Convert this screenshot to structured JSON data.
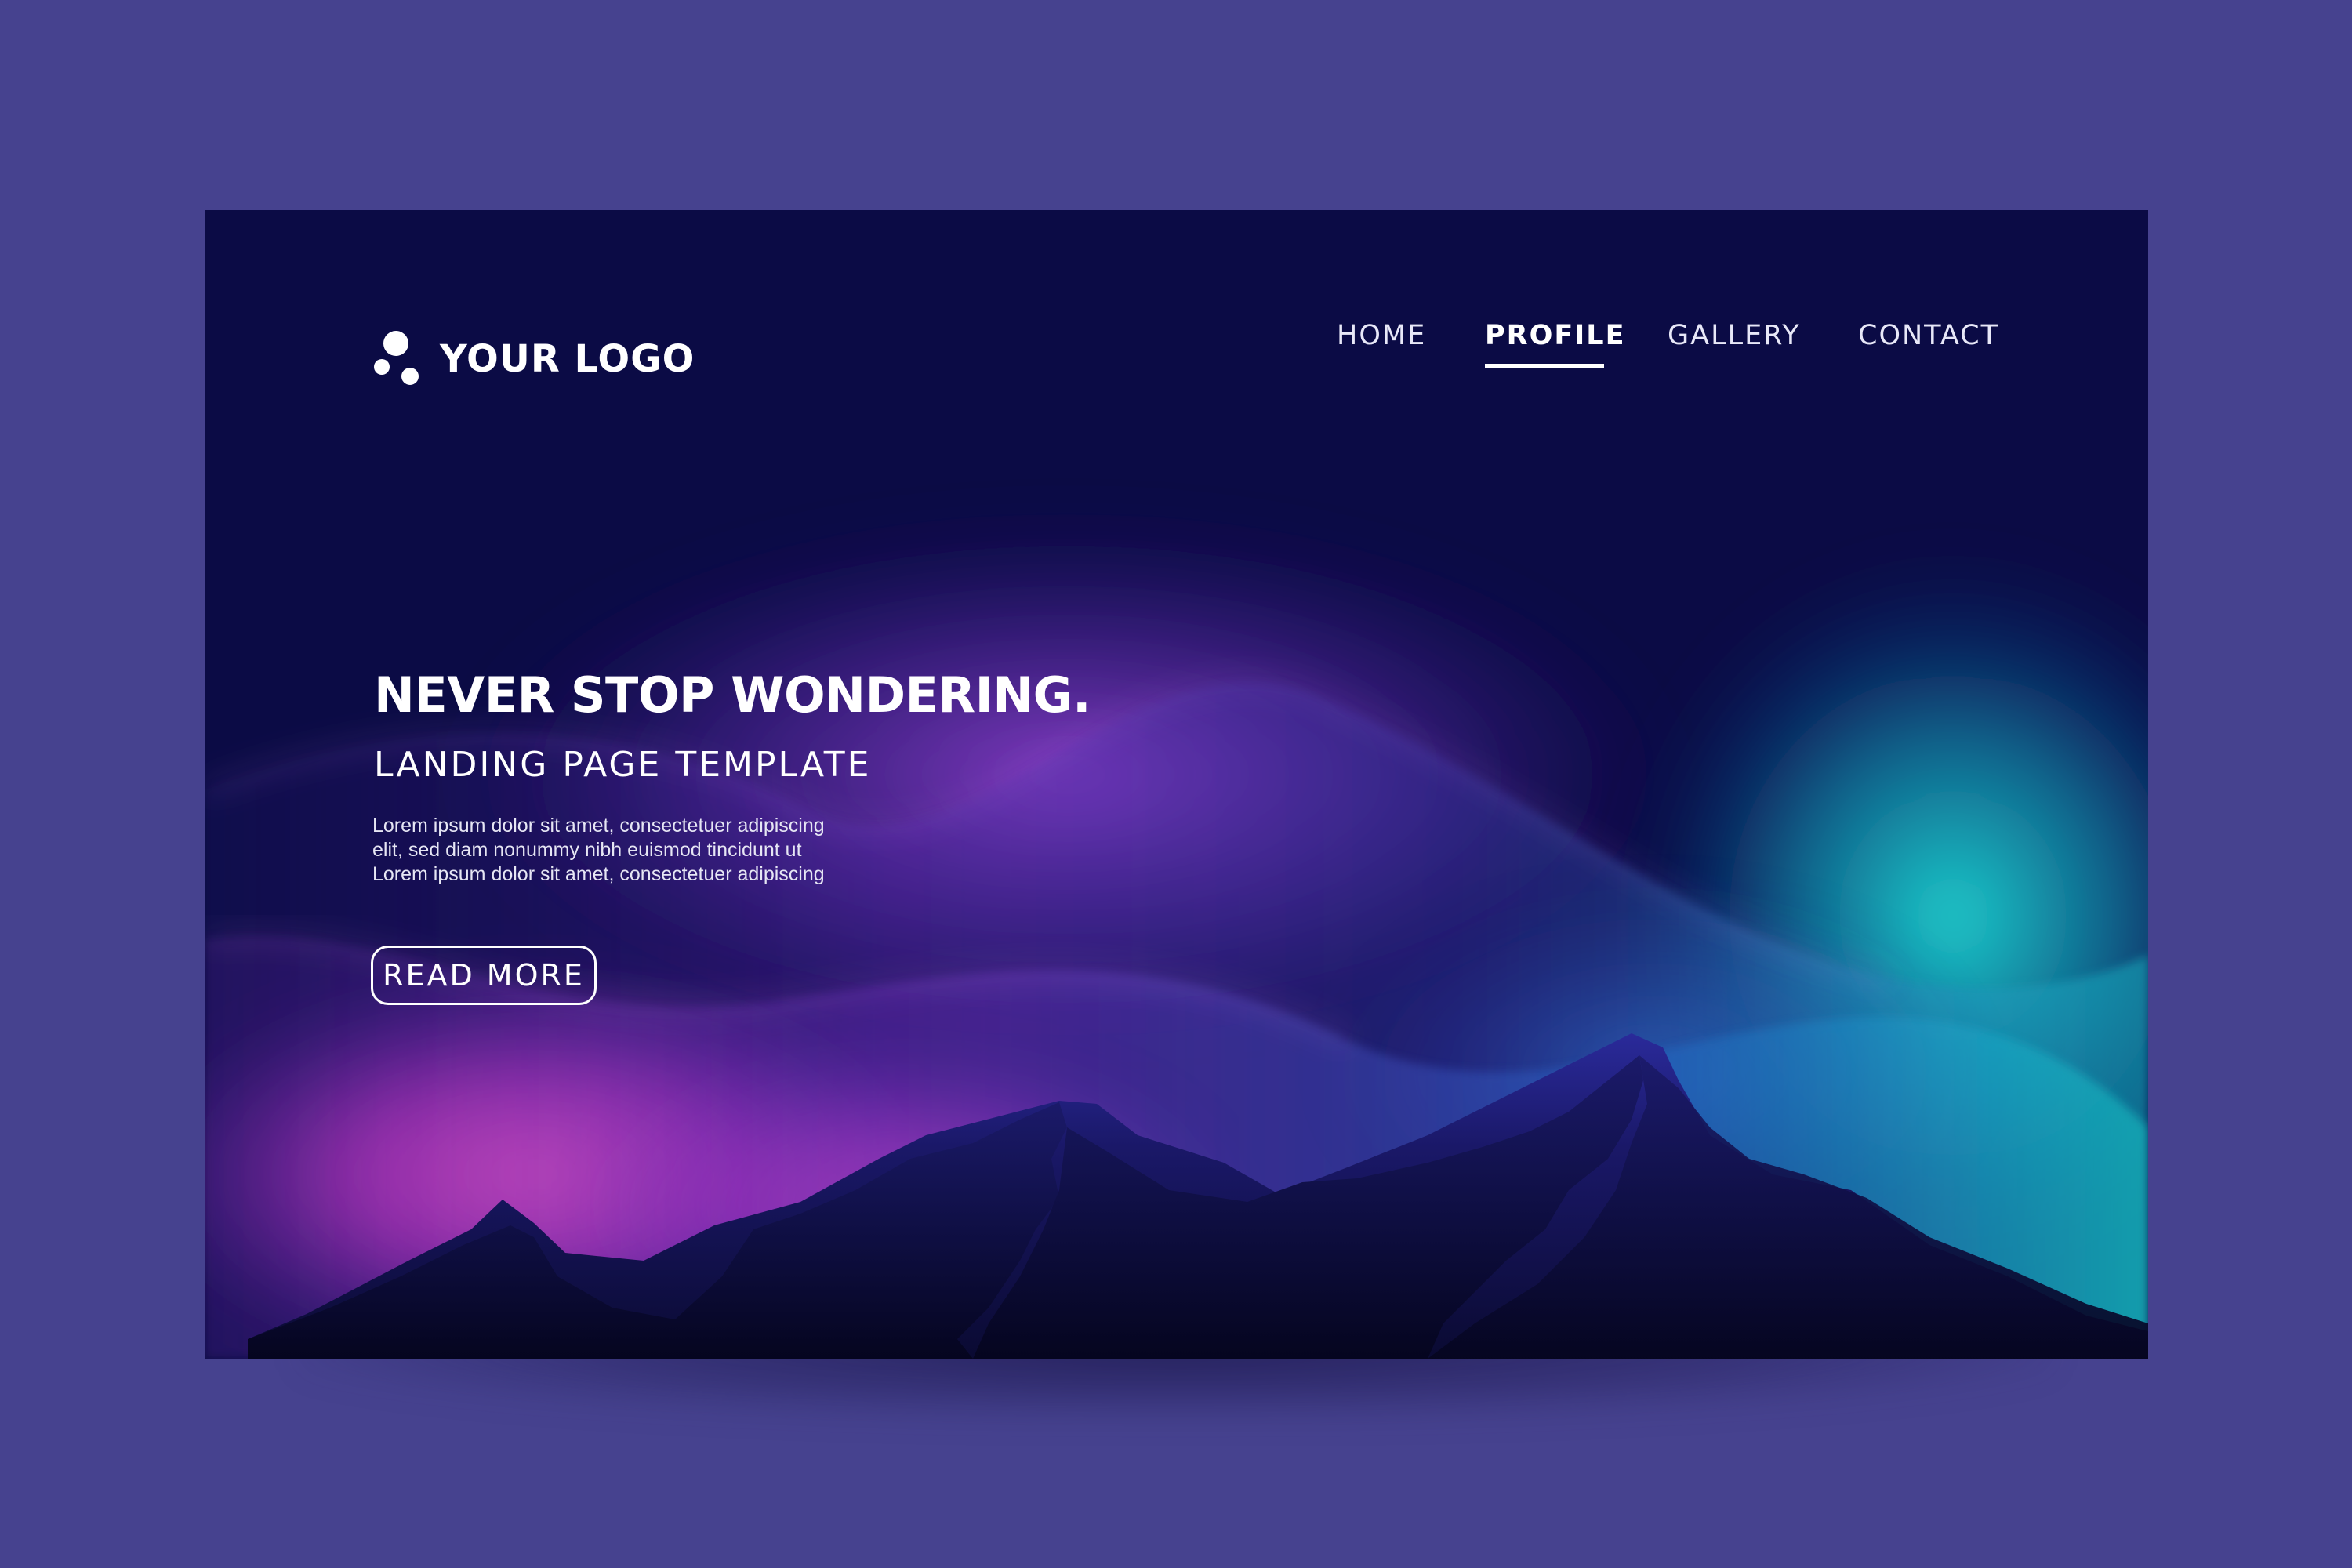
{
  "colors": {
    "outer_background": "#46428f",
    "card_background": "#0b0b45",
    "text": "#ffffff",
    "aurora_pink": "#ff4fc0",
    "aurora_purple": "#8a3fd6",
    "aurora_teal": "#19c6c9",
    "mountain": "#10103e"
  },
  "logo": {
    "icon": "three-dots-logo-icon",
    "text": "YOUR LOGO"
  },
  "nav": {
    "items": [
      {
        "label": "HOME",
        "active": false
      },
      {
        "label": "PROFILE",
        "active": true
      },
      {
        "label": "GALLERY",
        "active": false
      },
      {
        "label": "CONTACT",
        "active": false
      }
    ]
  },
  "hero": {
    "headline": "NEVER STOP WONDERING.",
    "subhead": "LANDING PAGE TEMPLATE",
    "body_lines": [
      "Lorem ipsum dolor sit amet, consectetuer adipiscing",
      "elit, sed diam nonummy nibh euismod tincidunt ut",
      "Lorem ipsum dolor sit amet, consectetuer adipiscing"
    ],
    "cta_label": "READ MORE"
  }
}
